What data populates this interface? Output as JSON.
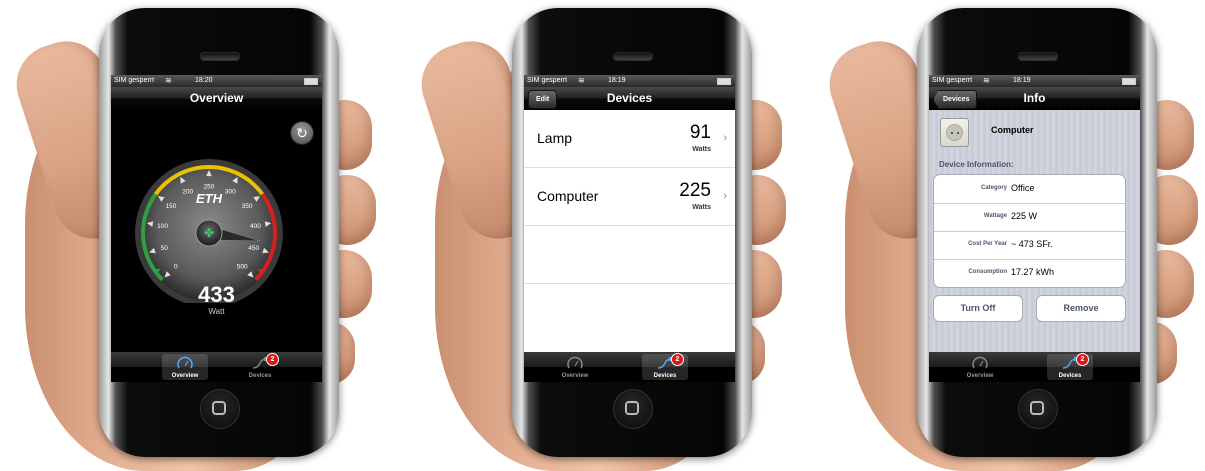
{
  "screens": [
    {
      "status": {
        "carrier": "SIM gesperrt",
        "time": "18:20"
      },
      "nav_title": "Overview",
      "gauge": {
        "logo": "ETH",
        "ticks": [
          "0",
          "50",
          "100",
          "150",
          "200",
          "250",
          "300",
          "350",
          "400",
          "450",
          "500"
        ],
        "value": "433",
        "unit": "Watt",
        "needle_value": 433,
        "scale_max": 500
      },
      "tabs": [
        {
          "label": "Overview",
          "icon": "speedometer-icon",
          "selected": true
        },
        {
          "label": "Devices",
          "icon": "plug-icon",
          "badge": "2",
          "selected": false
        }
      ]
    },
    {
      "status": {
        "carrier": "SIM gesperrt",
        "time": "18:19"
      },
      "nav_title": "Devices",
      "nav_button": "Edit",
      "devices": [
        {
          "name": "Lamp",
          "value": "91",
          "unit": "Watts"
        },
        {
          "name": "Computer",
          "value": "225",
          "unit": "Watts"
        }
      ],
      "tabs": [
        {
          "label": "Overview",
          "icon": "speedometer-icon",
          "selected": false
        },
        {
          "label": "Devices",
          "icon": "plug-icon",
          "badge": "2",
          "selected": true
        }
      ]
    },
    {
      "status": {
        "carrier": "SIM gesperrt",
        "time": "18:19"
      },
      "nav_title": "Info",
      "nav_button": "Devices",
      "device_name": "Computer",
      "section_title": "Device Information:",
      "fields": [
        {
          "key": "Category",
          "value": "Office"
        },
        {
          "key": "Wattage",
          "value": "225 W"
        },
        {
          "key": "Cost Per Year",
          "value": "~ 473 SFr."
        },
        {
          "key": "Consumption",
          "value": "17.27 kWh"
        }
      ],
      "buttons": {
        "turn_off": "Turn Off",
        "remove": "Remove"
      },
      "tabs": [
        {
          "label": "Overview",
          "icon": "speedometer-icon",
          "selected": false
        },
        {
          "label": "Devices",
          "icon": "plug-icon",
          "badge": "2",
          "selected": true
        }
      ]
    }
  ],
  "colors": {
    "gauge_green": "#2ea043",
    "gauge_yellow": "#e8c200",
    "gauge_red": "#d42020",
    "tab_selected": "#ffffff"
  }
}
